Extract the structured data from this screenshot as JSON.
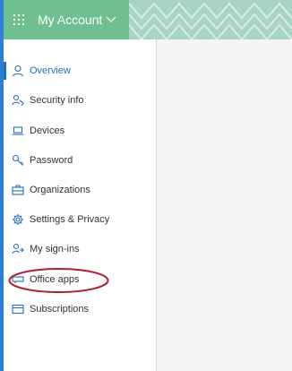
{
  "header": {
    "app_title": "My Account",
    "colors": {
      "brand": "#6fbf91",
      "pattern_bg": "#a9d3c3",
      "pattern_line": "#d7ece4"
    }
  },
  "sidebar": {
    "items": [
      {
        "label": "Overview",
        "icon": "person-icon",
        "active": true
      },
      {
        "label": "Security info",
        "icon": "security-info-icon",
        "active": false
      },
      {
        "label": "Devices",
        "icon": "laptop-icon",
        "active": false
      },
      {
        "label": "Password",
        "icon": "key-icon",
        "active": false
      },
      {
        "label": "Organizations",
        "icon": "briefcase-icon",
        "active": false
      },
      {
        "label": "Settings & Privacy",
        "icon": "gear-icon",
        "active": false
      },
      {
        "label": "My sign-ins",
        "icon": "sign-ins-icon",
        "active": false
      },
      {
        "label": "Office apps",
        "icon": "office-apps-icon",
        "active": false
      },
      {
        "label": "Subscriptions",
        "icon": "subscriptions-icon",
        "active": false
      }
    ]
  },
  "colors": {
    "accent": "#1f6fbf",
    "left_bar": "#2f7fd1",
    "annotation": "#b0202a",
    "content_bg": "#f4f4f4"
  }
}
